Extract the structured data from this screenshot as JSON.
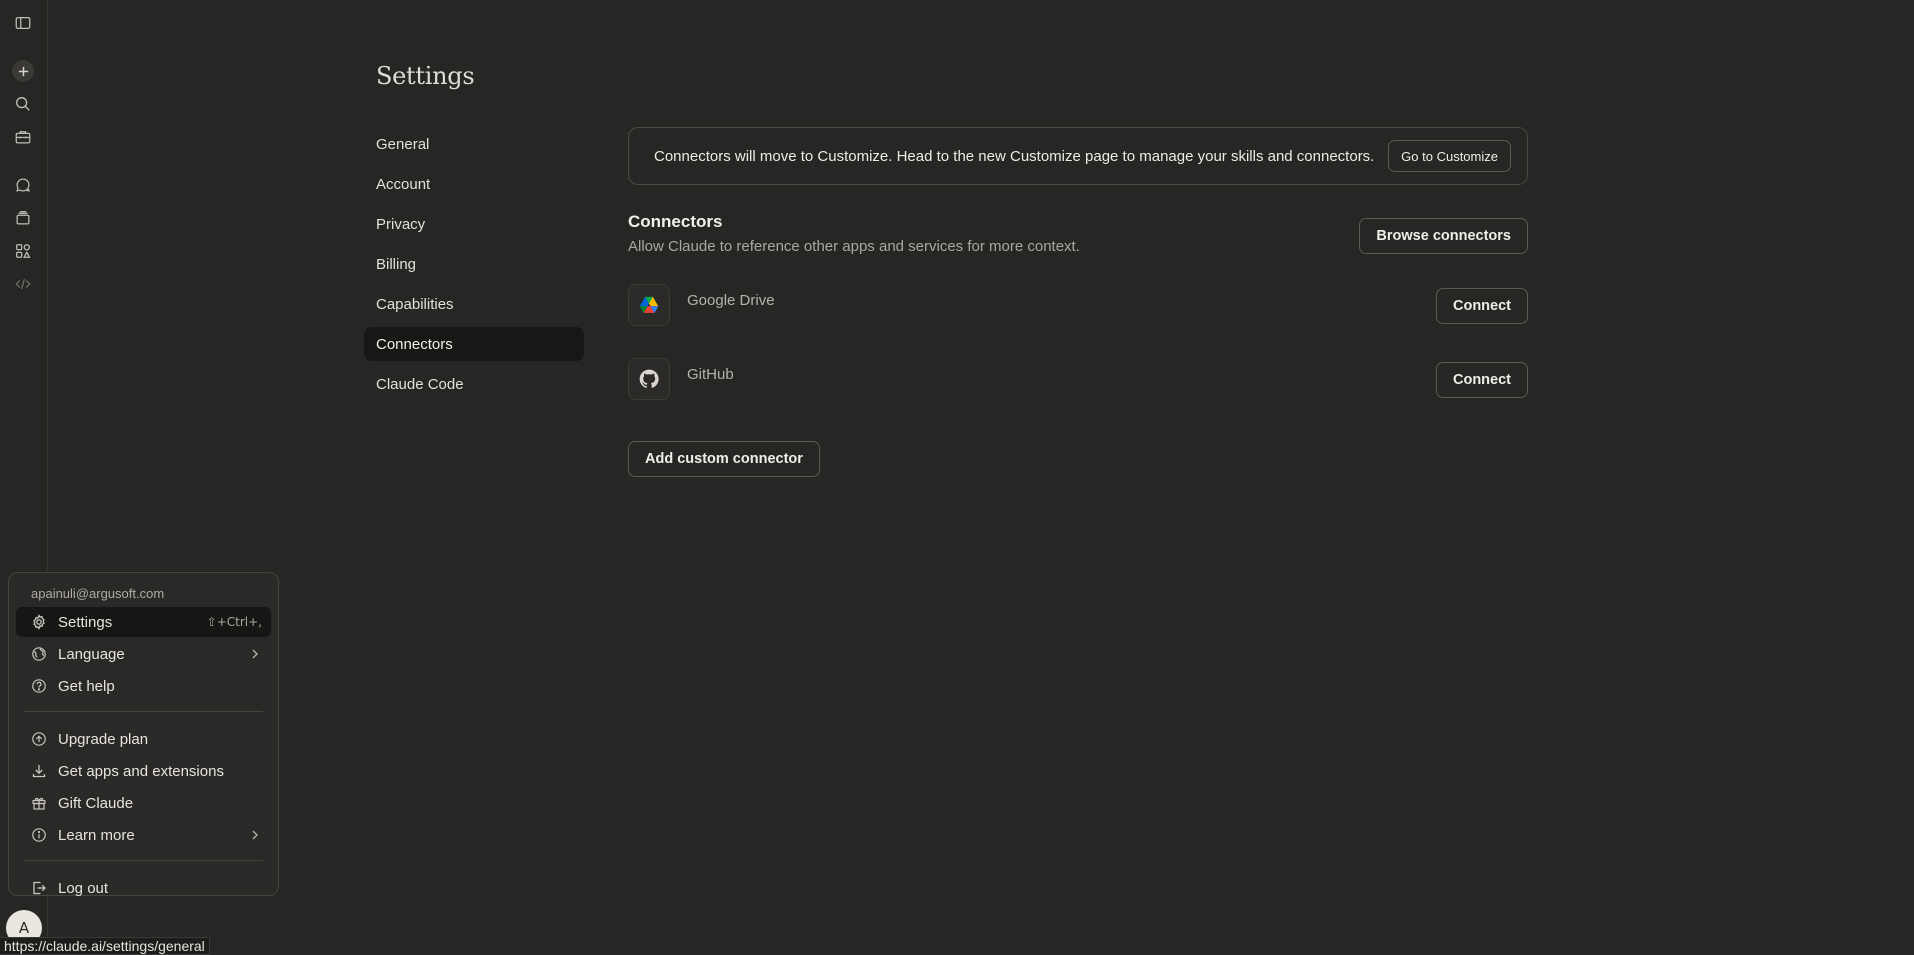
{
  "rail": {
    "items": [
      {
        "name": "sidebar-toggle-icon"
      },
      {
        "name": "new-chat-icon"
      },
      {
        "name": "search-icon"
      },
      {
        "name": "toolbox-icon"
      },
      {
        "name": "chats-icon"
      },
      {
        "name": "projects-icon"
      },
      {
        "name": "artifacts-icon"
      },
      {
        "name": "code-icon"
      }
    ],
    "avatar_initial": "A"
  },
  "settings": {
    "title": "Settings",
    "nav": [
      {
        "label": "General",
        "active": false
      },
      {
        "label": "Account",
        "active": false
      },
      {
        "label": "Privacy",
        "active": false
      },
      {
        "label": "Billing",
        "active": false
      },
      {
        "label": "Capabilities",
        "active": false
      },
      {
        "label": "Connectors",
        "active": true
      },
      {
        "label": "Claude Code",
        "active": false
      }
    ]
  },
  "banner": {
    "text": "Connectors will move to Customize. Head to the new Customize page to manage your skills and connectors.",
    "button": "Go to Customize"
  },
  "connectors": {
    "title": "Connectors",
    "description": "Allow Claude to reference other apps and services for more context.",
    "browse_button": "Browse connectors",
    "items": [
      {
        "name": "Google Drive",
        "icon": "google-drive-icon",
        "button": "Connect"
      },
      {
        "name": "GitHub",
        "icon": "github-icon",
        "button": "Connect"
      }
    ],
    "add_custom_button": "Add custom connector"
  },
  "menu": {
    "email": "apainuli@argusoft.com",
    "settings": {
      "label": "Settings",
      "shortcut": "⇧+Ctrl+,"
    },
    "language": "Language",
    "get_help": "Get help",
    "upgrade_plan": "Upgrade plan",
    "get_apps": "Get apps and extensions",
    "gift_claude": "Gift Claude",
    "learn_more": "Learn more",
    "log_out": "Log out"
  },
  "status_url": "https://claude.ai/settings/general",
  "colors": {
    "background": "#262624",
    "active_nav": "#171715",
    "border": "#4a4944",
    "text": "#e8e6df",
    "muted_text": "#a9a7a0"
  }
}
